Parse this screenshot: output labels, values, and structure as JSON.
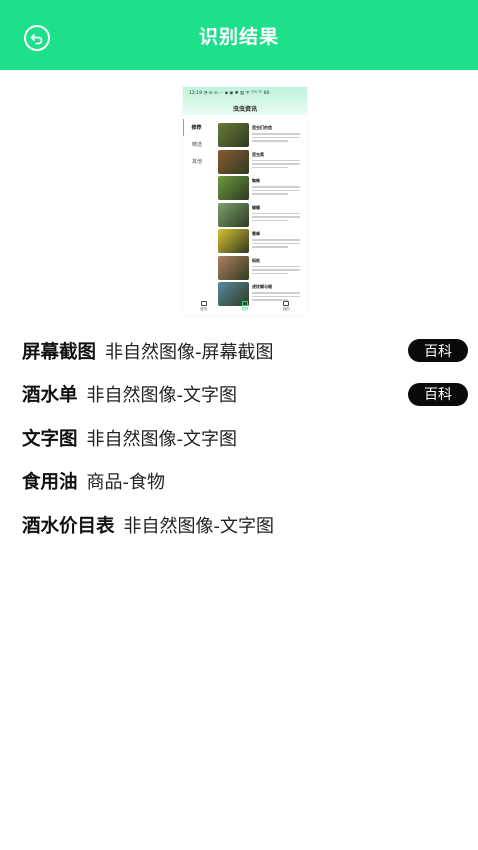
{
  "header": {
    "title": "识别结果",
    "back_icon": "back-arrow-icon",
    "background": "#1ee08a"
  },
  "preview": {
    "status": "12:19 ◔ ✉ ⊙ ··· ▪ ◉ ✱ ▥ ᯤ ⁵⁵ᴳ ⁵ᴳ 80",
    "title": "虫虫资讯",
    "sidebar": [
      "推荐",
      "精选",
      "其他"
    ],
    "items": [
      {
        "name": "昆虫们的信",
        "color": "#6a7a3a"
      },
      {
        "name": "昆虫黑",
        "color": "#8a5a30"
      },
      {
        "name": "蜘蛛",
        "color": "#6a9a40"
      },
      {
        "name": "蝴蝶",
        "color": "#7aa070"
      },
      {
        "name": "蜜蜂",
        "color": "#d8c030"
      },
      {
        "name": "蚂蚁",
        "color": "#b08060"
      },
      {
        "name": "虎纹蝶与蛾",
        "color": "#5a8aa0"
      }
    ],
    "tabs": [
      {
        "label": "首页",
        "active": false
      },
      {
        "label": "推荐",
        "active": true
      },
      {
        "label": "我的",
        "active": false
      }
    ]
  },
  "results": [
    {
      "name": "屏幕截图",
      "category": "非自然图像-屏幕截图",
      "badge": "百科"
    },
    {
      "name": "酒水单",
      "category": "非自然图像-文字图",
      "badge": "百科"
    },
    {
      "name": "文字图",
      "category": "非自然图像-文字图",
      "badge": ""
    },
    {
      "name": "食用油",
      "category": "商品-食物",
      "badge": ""
    },
    {
      "name": "酒水价目表",
      "category": "非自然图像-文字图",
      "badge": ""
    }
  ]
}
